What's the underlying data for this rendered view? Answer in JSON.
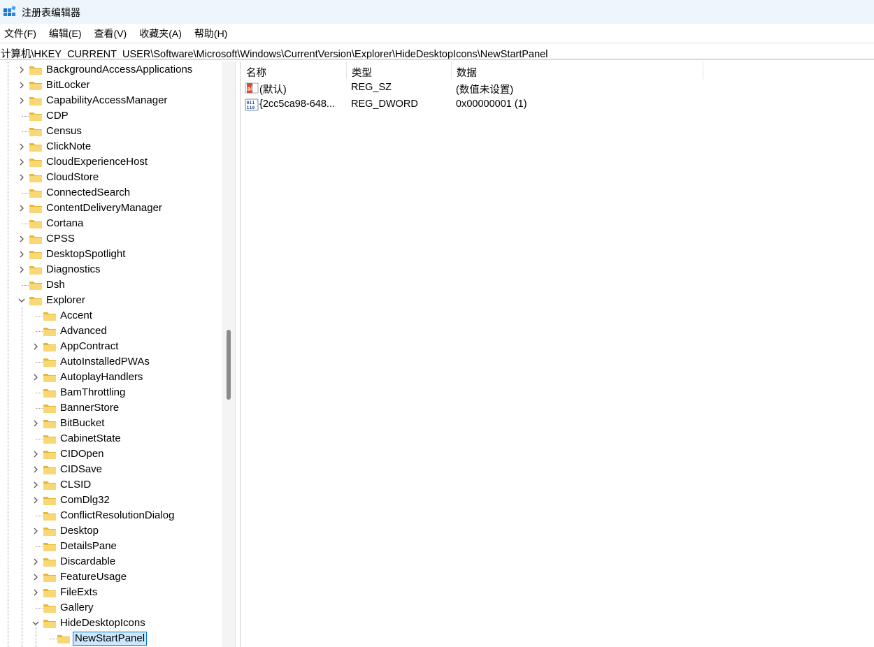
{
  "window": {
    "title": "注册表编辑器",
    "icon": "registry-editor-icon"
  },
  "menu": [
    {
      "id": "file",
      "label": "文件(F)"
    },
    {
      "id": "edit",
      "label": "编辑(E)"
    },
    {
      "id": "view",
      "label": "查看(V)"
    },
    {
      "id": "favorites",
      "label": "收藏夹(A)"
    },
    {
      "id": "help",
      "label": "帮助(H)"
    }
  ],
  "address": "计算机\\HKEY_CURRENT_USER\\Software\\Microsoft\\Windows\\CurrentVersion\\Explorer\\HideDesktopIcons\\NewStartPanel",
  "tree": {
    "items": [
      {
        "label": "BackgroundAccessApplications",
        "level": 0,
        "expander": "collapsed"
      },
      {
        "label": "BitLocker",
        "level": 0,
        "expander": "collapsed"
      },
      {
        "label": "CapabilityAccessManager",
        "level": 0,
        "expander": "collapsed"
      },
      {
        "label": "CDP",
        "level": 0,
        "expander": "none"
      },
      {
        "label": "Census",
        "level": 0,
        "expander": "none"
      },
      {
        "label": "ClickNote",
        "level": 0,
        "expander": "collapsed"
      },
      {
        "label": "CloudExperienceHost",
        "level": 0,
        "expander": "collapsed"
      },
      {
        "label": "CloudStore",
        "level": 0,
        "expander": "collapsed"
      },
      {
        "label": "ConnectedSearch",
        "level": 0,
        "expander": "none"
      },
      {
        "label": "ContentDeliveryManager",
        "level": 0,
        "expander": "collapsed"
      },
      {
        "label": "Cortana",
        "level": 0,
        "expander": "none"
      },
      {
        "label": "CPSS",
        "level": 0,
        "expander": "collapsed"
      },
      {
        "label": "DesktopSpotlight",
        "level": 0,
        "expander": "collapsed"
      },
      {
        "label": "Diagnostics",
        "level": 0,
        "expander": "collapsed"
      },
      {
        "label": "Dsh",
        "level": 0,
        "expander": "none"
      },
      {
        "label": "Explorer",
        "level": 0,
        "expander": "expanded"
      },
      {
        "label": "Accent",
        "level": 1,
        "expander": "none"
      },
      {
        "label": "Advanced",
        "level": 1,
        "expander": "none"
      },
      {
        "label": "AppContract",
        "level": 1,
        "expander": "collapsed"
      },
      {
        "label": "AutoInstalledPWAs",
        "level": 1,
        "expander": "none"
      },
      {
        "label": "AutoplayHandlers",
        "level": 1,
        "expander": "collapsed"
      },
      {
        "label": "BamThrottling",
        "level": 1,
        "expander": "none"
      },
      {
        "label": "BannerStore",
        "level": 1,
        "expander": "none"
      },
      {
        "label": "BitBucket",
        "level": 1,
        "expander": "collapsed"
      },
      {
        "label": "CabinetState",
        "level": 1,
        "expander": "none"
      },
      {
        "label": "CIDOpen",
        "level": 1,
        "expander": "collapsed"
      },
      {
        "label": "CIDSave",
        "level": 1,
        "expander": "collapsed"
      },
      {
        "label": "CLSID",
        "level": 1,
        "expander": "collapsed"
      },
      {
        "label": "ComDlg32",
        "level": 1,
        "expander": "collapsed"
      },
      {
        "label": "ConflictResolutionDialog",
        "level": 1,
        "expander": "none"
      },
      {
        "label": "Desktop",
        "level": 1,
        "expander": "collapsed"
      },
      {
        "label": "DetailsPane",
        "level": 1,
        "expander": "none"
      },
      {
        "label": "Discardable",
        "level": 1,
        "expander": "collapsed"
      },
      {
        "label": "FeatureUsage",
        "level": 1,
        "expander": "collapsed"
      },
      {
        "label": "FileExts",
        "level": 1,
        "expander": "collapsed"
      },
      {
        "label": "Gallery",
        "level": 1,
        "expander": "none"
      },
      {
        "label": "HideDesktopIcons",
        "level": 1,
        "expander": "expanded"
      },
      {
        "label": "NewStartPanel",
        "level": 2,
        "expander": "none",
        "selected": true
      }
    ]
  },
  "values": {
    "columns": [
      {
        "id": "name",
        "label": "名称"
      },
      {
        "id": "type",
        "label": "类型"
      },
      {
        "id": "data",
        "label": "数据"
      }
    ],
    "rows": [
      {
        "icon": "string-value-icon",
        "name": "(默认)",
        "type": "REG_SZ",
        "data": "(数值未设置)"
      },
      {
        "icon": "dword-value-icon",
        "name": "{2cc5ca98-648...",
        "type": "REG_DWORD",
        "data": "0x00000001 (1)"
      }
    ]
  },
  "colors": {
    "selection_bg": "#cce8ff",
    "selection_border": "#0078d7",
    "folder": "#f8d775",
    "titlebar_bg": "#eef5fb"
  }
}
